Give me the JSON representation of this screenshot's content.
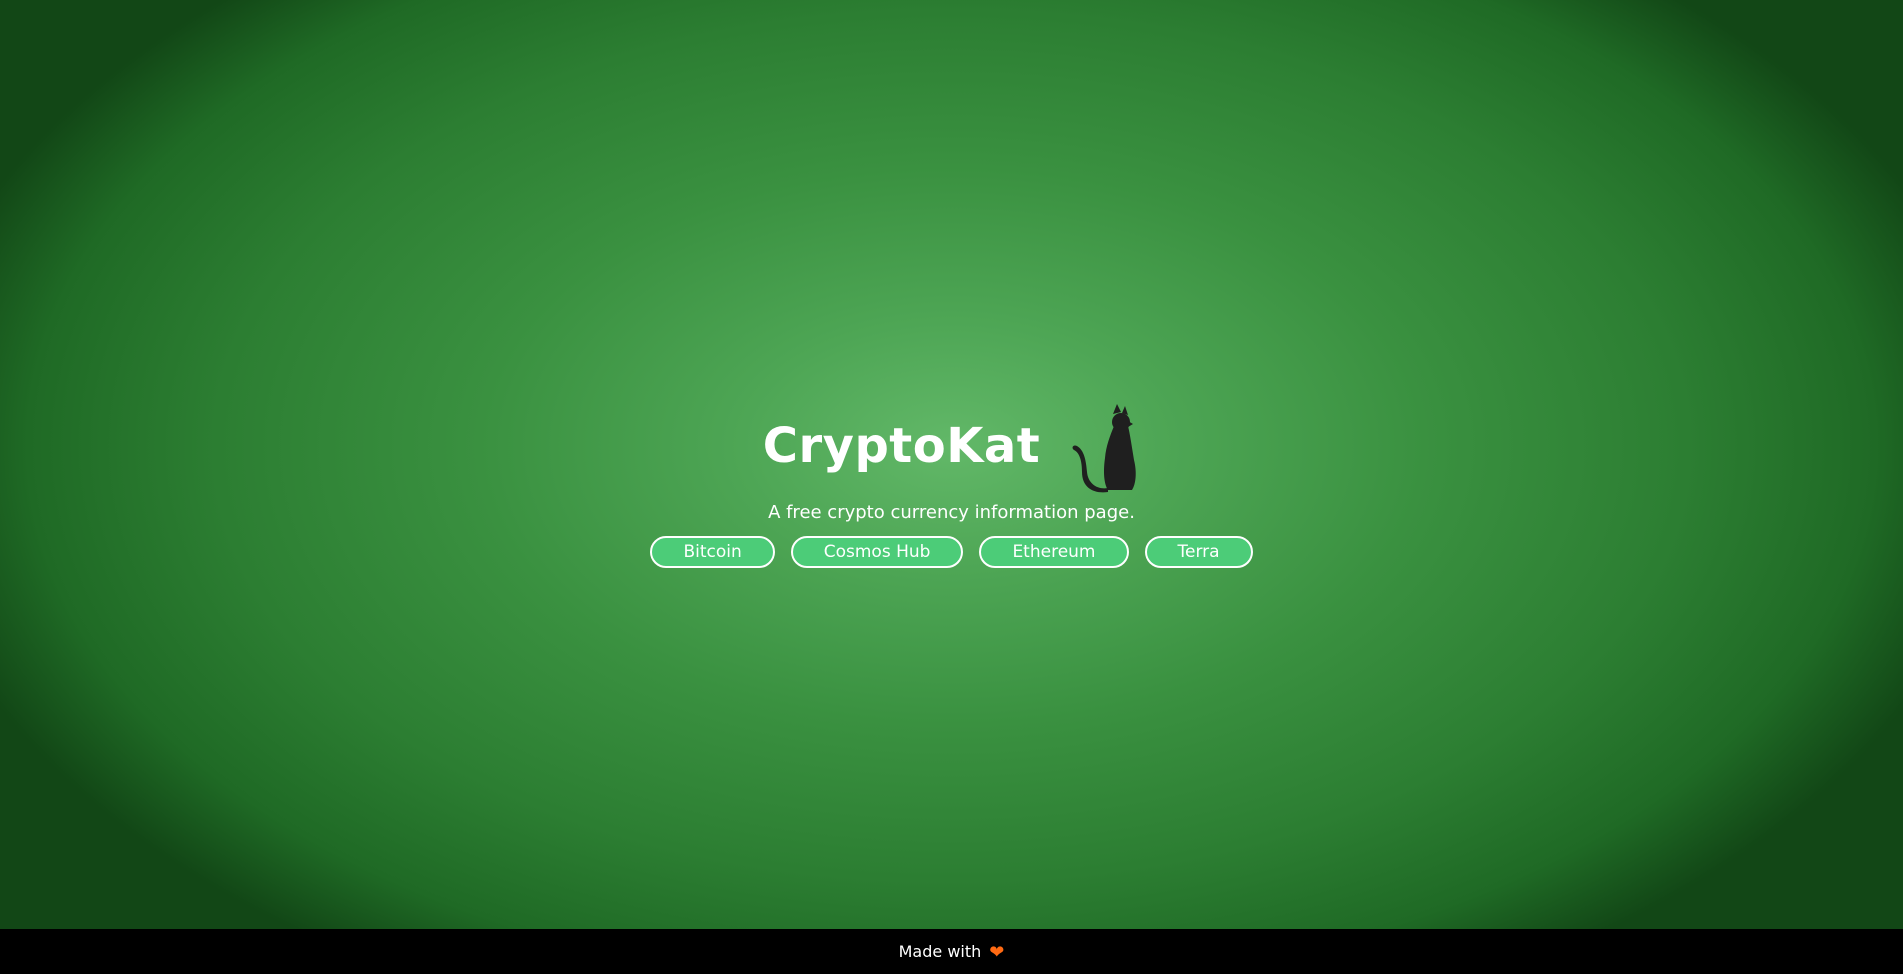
{
  "hero": {
    "title": "CryptoKat",
    "logo_icon": "cat-silhouette-icon",
    "tagline": "A free crypto currency information page."
  },
  "coins": [
    {
      "label": "Bitcoin"
    },
    {
      "label": "Cosmos Hub"
    },
    {
      "label": "Ethereum"
    },
    {
      "label": "Terra"
    }
  ],
  "footer": {
    "text": "Made with",
    "icon": "heart-icon"
  },
  "colors": {
    "background_center": "#62b868",
    "background_edge": "#124716",
    "button_fill": "#4ccc78",
    "button_border": "#ffffff",
    "footer_background": "#000000",
    "heart": "#ff6a13",
    "cat": "#1f1f1f"
  }
}
